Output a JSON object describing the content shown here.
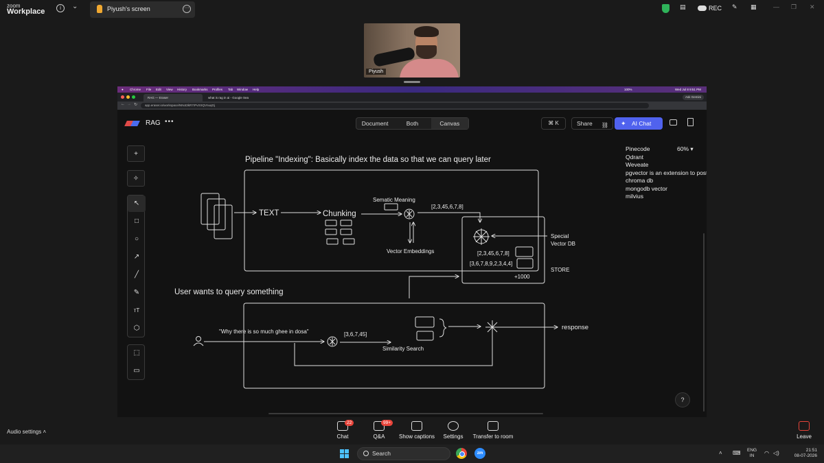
{
  "zoom": {
    "logo_line1": "zoom",
    "logo_line2": "Workplace",
    "share_title": "Piyush's screen",
    "rec_label": "REC",
    "participant_name": "Piyush",
    "audio_settings": "Audio settings",
    "controls": [
      {
        "label": "Chat",
        "badge": "22"
      },
      {
        "label": "Q&A",
        "badge": "99+"
      },
      {
        "label": "Show captions",
        "badge": ""
      },
      {
        "label": "Settings",
        "badge": ""
      },
      {
        "label": "Transfer to room",
        "badge": ""
      }
    ],
    "leave_label": "Leave"
  },
  "browser": {
    "menu": [
      "Chrome",
      "File",
      "Edit",
      "View",
      "History",
      "Bookmarks",
      "Profiles",
      "Tab",
      "Window",
      "Help"
    ],
    "clock": "Wed Jul 8  9:51 PM",
    "battery": "100%",
    "tabs": [
      {
        "label": "RAG — Eraser"
      },
      {
        "label": "what is rag in ai - Google Sea"
      }
    ],
    "ask_gemini": "Ask Gemini",
    "url": "app.eraser.io/workspace/NNot3kR7rPvXSQVnuqGj"
  },
  "app": {
    "name": "RAG",
    "more": "•••",
    "view_modes": [
      {
        "label": "Document",
        "active": false
      },
      {
        "label": "Both",
        "active": false
      },
      {
        "label": "Canvas",
        "active": true
      }
    ],
    "shortcut": "⌘ K",
    "share_label": "Share",
    "ai_chat_label": "AI Chat",
    "zoom_level": "60%",
    "help": "?"
  },
  "tools": {
    "add": "+",
    "items": [
      "select",
      "rectangle",
      "ellipse",
      "arrow",
      "line",
      "pen",
      "text",
      "shapes"
    ],
    "text_tool": "ᴛT"
  },
  "diagram": {
    "indexing_title": "Pipeline \"Indexing\": Basically index the data so that we can query later",
    "text_node": "TEXT",
    "chunking": "Chunking",
    "semantic_meaning": "Sematic Meaning",
    "vector_top": "[2,3,45,6,7,8]",
    "vector_embeddings": "Vector Embeddings",
    "store_row1": "[2,3,45,6,7,8]",
    "store_row2": "[3,6,7,8,9,2,3,4,4]",
    "store_count": "+1000",
    "special_db_1": "Special",
    "special_db_2": "Vector DB",
    "store_label": "STORE",
    "query_title": "User wants to query something",
    "query_text": "\"Why there is so much ghee in dosa\"",
    "query_vector": "[3,6,7,45]",
    "similarity_search": "Similarity Search",
    "response": "response"
  },
  "vector_dbs": [
    "Pinecode",
    "Qdrant",
    "Weveate",
    "pgvector is an extension to postgres",
    "chroma db",
    "mongodb vector",
    "milvius"
  ],
  "taskbar": {
    "search_placeholder": "Search",
    "lang_1": "ENG",
    "lang_2": "IN",
    "time": "21:51",
    "date": "08-07-2026",
    "zoom_icon_text": "zm"
  }
}
